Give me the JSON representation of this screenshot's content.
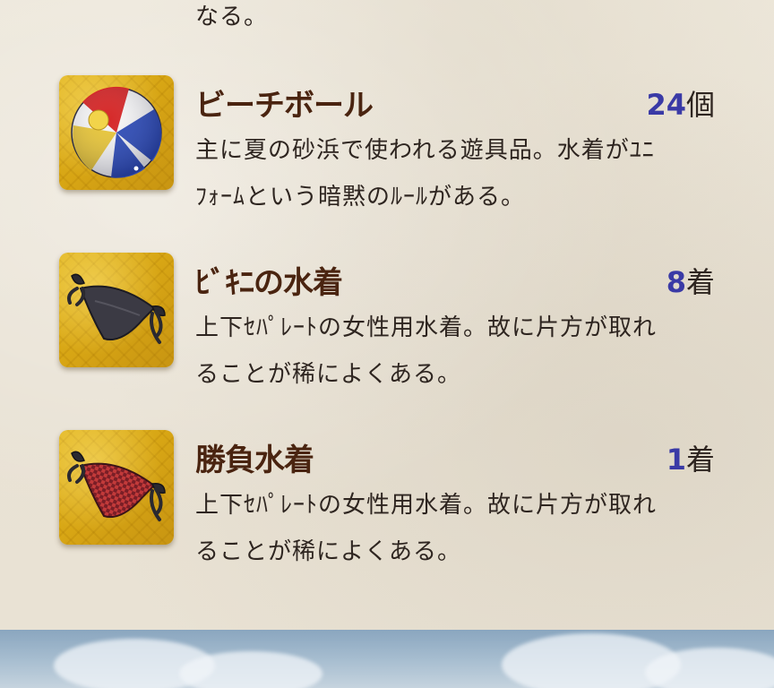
{
  "top_text": "なる。",
  "items": [
    {
      "name": "ビーチボール",
      "count": "24",
      "unit": "個",
      "desc_line1": "主に夏の砂浜で使われる遊具品。水着がﾕﾆ",
      "desc_line2": "ﾌｫｰﾑという暗黙のﾙｰﾙがある。",
      "icon": "beach-ball-icon"
    },
    {
      "name": "ﾋﾞｷﾆの水着",
      "count": "8",
      "unit": "着",
      "desc_line1": "上下ｾﾊﾟﾚｰﾄの女性用水着。故に片方が取れ",
      "desc_line2": "ることが稀によくある。",
      "icon": "black-bikini-icon"
    },
    {
      "name": "勝負水着",
      "count": "1",
      "unit": "着",
      "desc_line1": "上下ｾﾊﾟﾚｰﾄの女性用水着。故に片方が取れ",
      "desc_line2": "ることが稀によくある。",
      "icon": "red-bikini-icon"
    }
  ],
  "colors": {
    "name": "#4a2410",
    "count_number": "#3a3aa6",
    "text": "#2e2520",
    "icon_bg": "#d7a514"
  }
}
